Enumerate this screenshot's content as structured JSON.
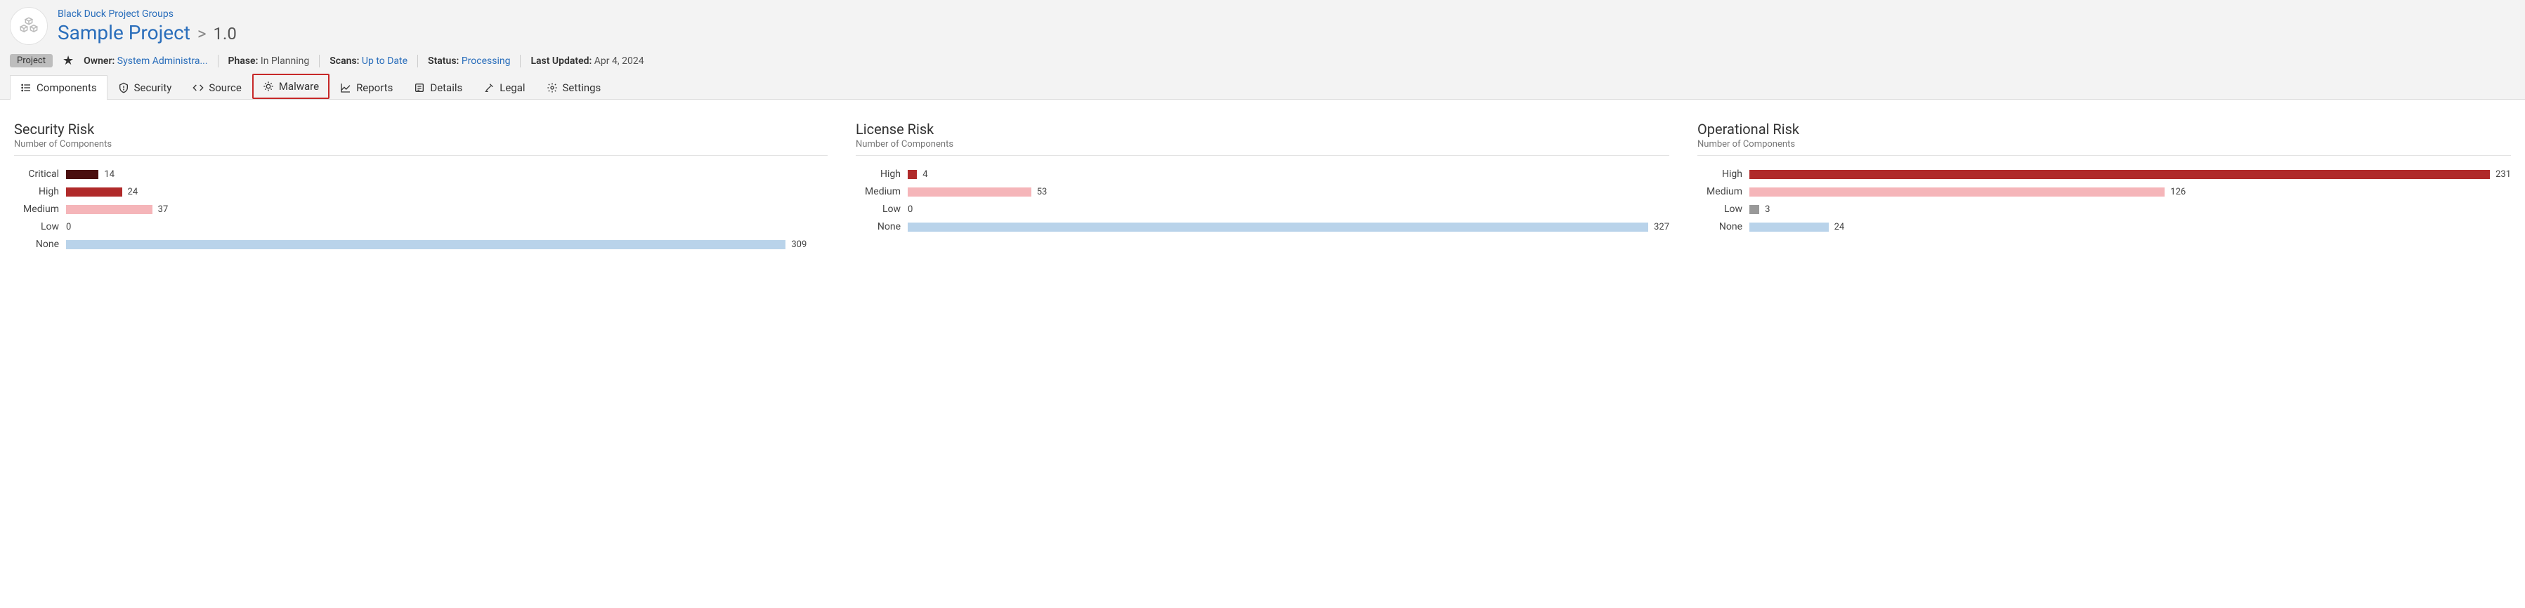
{
  "header": {
    "breadcrumb_top": "Black Duck Project Groups",
    "project_name": "Sample Project",
    "separator": ">",
    "version": "1.0",
    "badge": "Project",
    "meta": {
      "owner_label": "Owner:",
      "owner_value": "System Administra...",
      "phase_label": "Phase:",
      "phase_value": "In Planning",
      "scans_label": "Scans:",
      "scans_value": "Up to Date",
      "status_label": "Status:",
      "status_value": "Processing",
      "updated_label": "Last Updated:",
      "updated_value": "Apr 4, 2024"
    }
  },
  "tabs": {
    "components": "Components",
    "security": "Security",
    "source": "Source",
    "malware": "Malware",
    "reports": "Reports",
    "details": "Details",
    "legal": "Legal",
    "settings": "Settings"
  },
  "panels": {
    "security": {
      "title": "Security Risk",
      "sub": "Number of Components"
    },
    "license": {
      "title": "License Risk",
      "sub": "Number of Components"
    },
    "operational": {
      "title": "Operational Risk",
      "sub": "Number of Components"
    }
  },
  "colors": {
    "critical": "#4a0e0e",
    "high": "#b02a2a",
    "medium": "#f5b5b9",
    "low": "#999",
    "none": "#b9d3ea"
  },
  "chart_data": [
    {
      "type": "bar",
      "title": "Security Risk",
      "ylabel": "Number of Components",
      "categories": [
        "Critical",
        "High",
        "Medium",
        "Low",
        "None"
      ],
      "values": [
        14,
        24,
        37,
        0,
        309
      ],
      "color_keys": [
        "critical",
        "high",
        "medium",
        "low",
        "none"
      ],
      "max": 327
    },
    {
      "type": "bar",
      "title": "License Risk",
      "ylabel": "Number of Components",
      "categories": [
        "High",
        "Medium",
        "Low",
        "None"
      ],
      "values": [
        4,
        53,
        0,
        327
      ],
      "color_keys": [
        "high",
        "medium",
        "low",
        "none"
      ],
      "max": 327
    },
    {
      "type": "bar",
      "title": "Operational Risk",
      "ylabel": "Number of Components",
      "categories": [
        "High",
        "Medium",
        "Low",
        "None"
      ],
      "values": [
        231,
        126,
        3,
        24
      ],
      "color_keys": [
        "high",
        "medium",
        "low",
        "none"
      ],
      "max": 231
    }
  ]
}
